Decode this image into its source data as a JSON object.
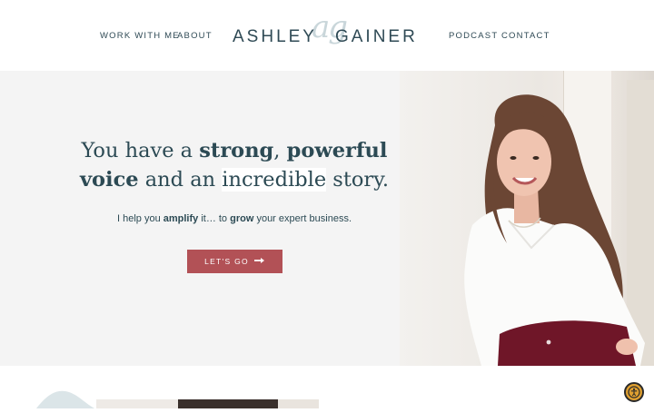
{
  "nav": {
    "left_links": [
      "WORK WITH ME",
      "ABOUT"
    ],
    "right_links": [
      "PODCAST",
      "CONTACT"
    ],
    "logo_monogram": "ag",
    "logo_first": "ASHLEY",
    "logo_last": "GAINER"
  },
  "hero": {
    "headline_parts": [
      "You have a ",
      "strong",
      ", ",
      "powerful",
      "voice",
      " and an ",
      "incredible",
      " story."
    ],
    "sub_parts": [
      "I help you ",
      "amplify",
      " it… to ",
      "grow",
      " your expert business."
    ],
    "cta_label": "LET'S GO",
    "cta_icon": "arrow-right-icon"
  },
  "colors": {
    "text": "#2c4a54",
    "accent": "#b25156",
    "hero_bg": "#f4f4f4",
    "logo_monogram": "#c9d6da",
    "accessibility_button": "#e0a030"
  },
  "accessibility": {
    "icon": "accessibility-icon"
  }
}
